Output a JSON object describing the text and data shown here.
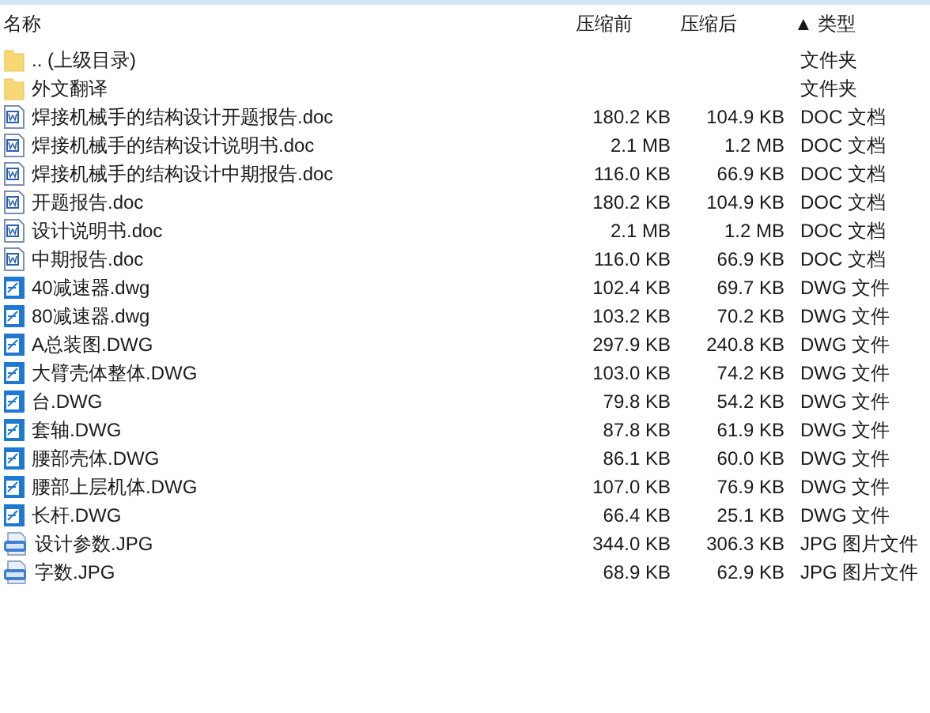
{
  "columns": [
    {
      "label": "名称"
    },
    {
      "label": "压缩前"
    },
    {
      "label": "压缩后"
    },
    {
      "label": "▲ 类型"
    }
  ],
  "rows": [
    {
      "kind": "folder",
      "name": ".. (上级目录)",
      "before": "",
      "after": "",
      "type": "文件夹"
    },
    {
      "kind": "folder",
      "name": "外文翻译",
      "before": "",
      "after": "",
      "type": "文件夹"
    },
    {
      "kind": "doc",
      "name": "焊接机械手的结构设计开题报告.doc",
      "before": "180.2 KB",
      "after": "104.9 KB",
      "type": "DOC 文档"
    },
    {
      "kind": "doc",
      "name": "焊接机械手的结构设计说明书.doc",
      "before": "2.1 MB",
      "after": "1.2 MB",
      "type": "DOC 文档"
    },
    {
      "kind": "doc",
      "name": "焊接机械手的结构设计中期报告.doc",
      "before": "116.0 KB",
      "after": "66.9 KB",
      "type": "DOC 文档"
    },
    {
      "kind": "doc",
      "name": "开题报告.doc",
      "before": "180.2 KB",
      "after": "104.9 KB",
      "type": "DOC 文档"
    },
    {
      "kind": "doc",
      "name": "设计说明书.doc",
      "before": "2.1 MB",
      "after": "1.2 MB",
      "type": "DOC 文档"
    },
    {
      "kind": "doc",
      "name": "中期报告.doc",
      "before": "116.0 KB",
      "after": "66.9 KB",
      "type": "DOC 文档"
    },
    {
      "kind": "dwg",
      "name": "40减速器.dwg",
      "before": "102.4 KB",
      "after": "69.7 KB",
      "type": "DWG 文件"
    },
    {
      "kind": "dwg",
      "name": "80减速器.dwg",
      "before": "103.2 KB",
      "after": "70.2 KB",
      "type": "DWG 文件"
    },
    {
      "kind": "dwg",
      "name": "A总装图.DWG",
      "before": "297.9 KB",
      "after": "240.8 KB",
      "type": "DWG 文件"
    },
    {
      "kind": "dwg",
      "name": "大臂壳体整体.DWG",
      "before": "103.0 KB",
      "after": "74.2 KB",
      "type": "DWG 文件"
    },
    {
      "kind": "dwg",
      "name": "台.DWG",
      "before": "79.8 KB",
      "after": "54.2 KB",
      "type": "DWG 文件"
    },
    {
      "kind": "dwg",
      "name": "套轴.DWG",
      "before": "87.8 KB",
      "after": "61.9 KB",
      "type": "DWG 文件"
    },
    {
      "kind": "dwg",
      "name": "腰部壳体.DWG",
      "before": "86.1 KB",
      "after": "60.0 KB",
      "type": "DWG 文件"
    },
    {
      "kind": "dwg",
      "name": "腰部上层机体.DWG",
      "before": "107.0 KB",
      "after": "76.9 KB",
      "type": "DWG 文件"
    },
    {
      "kind": "dwg",
      "name": "长杆.DWG",
      "before": "66.4 KB",
      "after": "25.1 KB",
      "type": "DWG 文件"
    },
    {
      "kind": "jpg",
      "name": "设计参数.JPG",
      "before": "344.0 KB",
      "after": "306.3 KB",
      "type": "JPG 图片文件"
    },
    {
      "kind": "jpg",
      "name": "字数.JPG",
      "before": "68.9 KB",
      "after": "62.9 KB",
      "type": "JPG 图片文件"
    }
  ]
}
